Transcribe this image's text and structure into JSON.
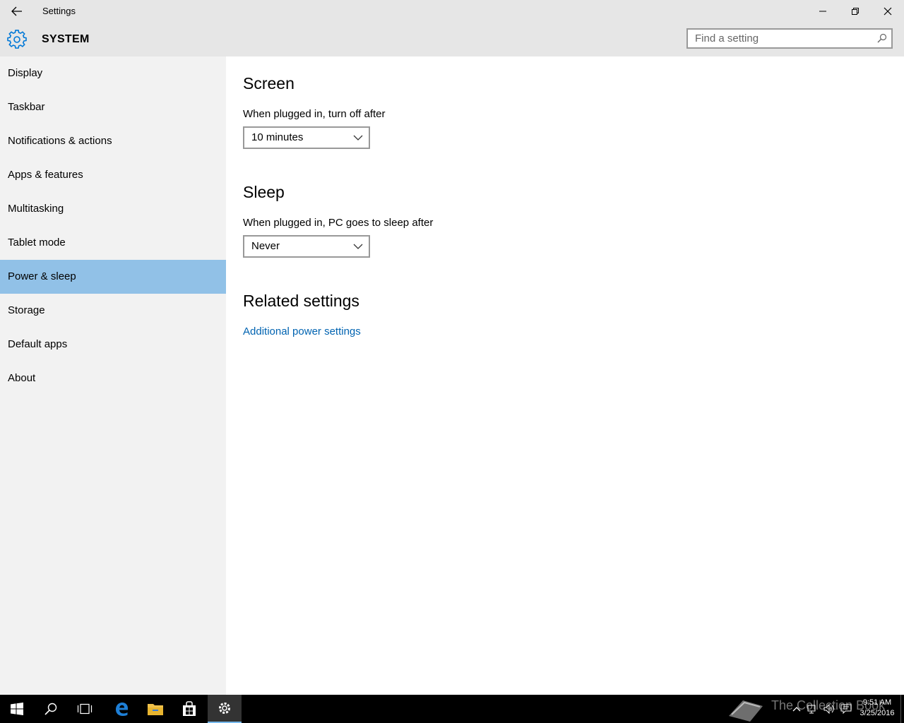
{
  "window": {
    "title": "Settings"
  },
  "header": {
    "title": "SYSTEM",
    "search_placeholder": "Find a setting"
  },
  "sidebar": {
    "items": [
      {
        "label": "Display"
      },
      {
        "label": "Taskbar"
      },
      {
        "label": "Notifications & actions"
      },
      {
        "label": "Apps & features"
      },
      {
        "label": "Multitasking"
      },
      {
        "label": "Tablet mode"
      },
      {
        "label": "Power & sleep",
        "selected": true
      },
      {
        "label": "Storage"
      },
      {
        "label": "Default apps"
      },
      {
        "label": "About"
      }
    ]
  },
  "main": {
    "screen": {
      "heading": "Screen",
      "label": "When plugged in, turn off after",
      "value": "10 minutes"
    },
    "sleep": {
      "heading": "Sleep",
      "label": "When plugged in, PC goes to sleep after",
      "value": "Never"
    },
    "related": {
      "heading": "Related settings",
      "link": "Additional power settings"
    }
  },
  "taskbar": {
    "apps": [
      "start-icon",
      "search-icon",
      "task-view-icon",
      "edge-icon",
      "file-explorer-icon",
      "store-icon",
      "settings-icon"
    ],
    "watermark": "The Collection Book",
    "time": "9:51 AM",
    "date": "3/25/2016"
  },
  "colors": {
    "accent": "#0078d7",
    "selected_nav": "#91c1e7",
    "link": "#0063b1"
  }
}
